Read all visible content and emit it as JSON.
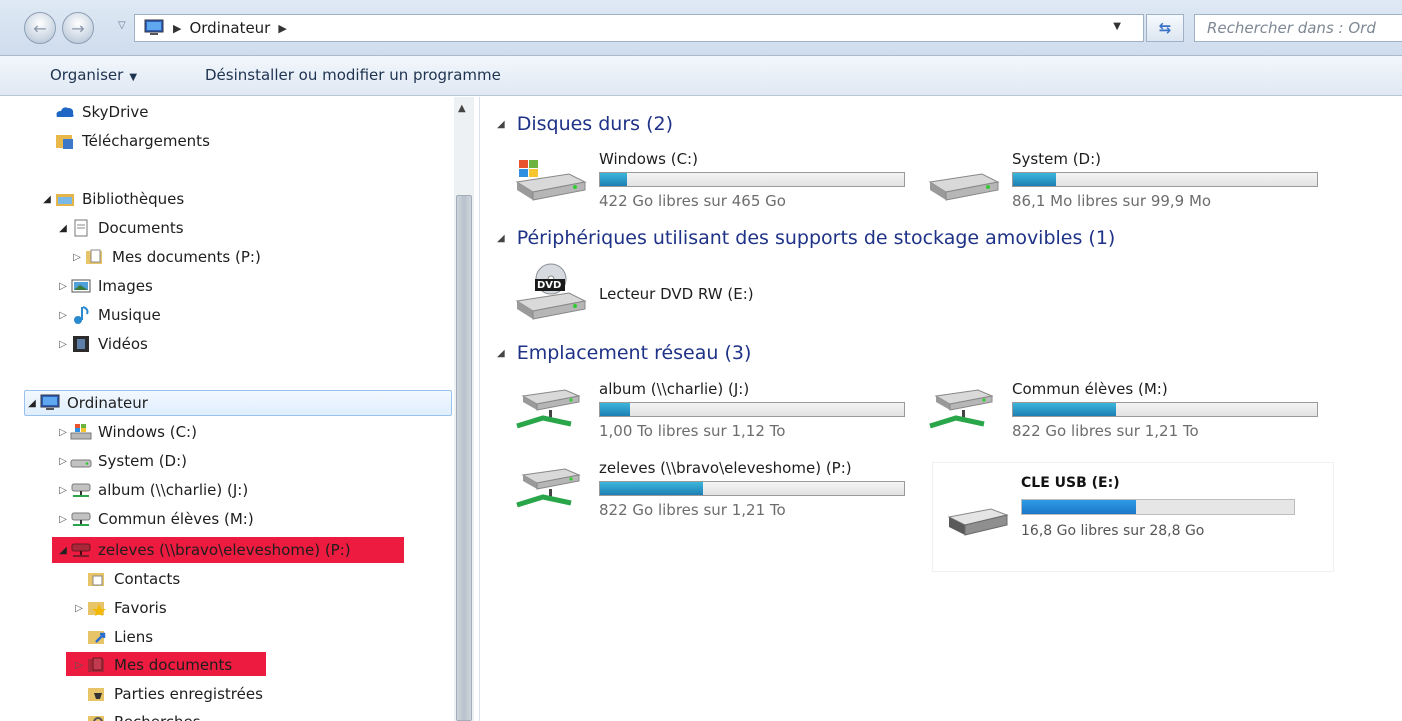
{
  "address_bar": {
    "breadcrumb": "Ordinateur",
    "search_placeholder": "Rechercher dans : Ord"
  },
  "command_bar": {
    "organize_label": "Organiser",
    "uninstall_label": "Désinstaller ou modifier un programme"
  },
  "nav": {
    "items": [
      {
        "label": "SkyDrive"
      },
      {
        "label": "Téléchargements"
      },
      {
        "label": "Bibliothèques"
      },
      {
        "label": "Documents"
      },
      {
        "label": "Mes documents (P:)"
      },
      {
        "label": "Images"
      },
      {
        "label": "Musique"
      },
      {
        "label": "Vidéos"
      },
      {
        "label": "Ordinateur"
      },
      {
        "label": "Windows (C:)"
      },
      {
        "label": "System (D:)"
      },
      {
        "label": "album (\\\\charlie) (J:)"
      },
      {
        "label": "Commun élèves (M:)"
      },
      {
        "label": "zeleves (\\\\bravo\\eleveshome) (P:)"
      },
      {
        "label": "Contacts"
      },
      {
        "label": "Favoris"
      },
      {
        "label": "Liens"
      },
      {
        "label": "Mes documents"
      },
      {
        "label": "Parties enregistrées"
      },
      {
        "label": "Recherches"
      }
    ]
  },
  "content": {
    "groups": [
      {
        "title": "Disques durs (2)"
      },
      {
        "title": "Périphériques utilisant des supports de stockage amovibles (1)"
      },
      {
        "title": "Emplacement réseau (3)"
      }
    ],
    "drives": [
      {
        "name": "Windows (C:)",
        "free": "422 Go libres sur 465 Go",
        "used_fraction": 0.09
      },
      {
        "name": "System (D:)",
        "free": "86,1 Mo libres sur 99,9 Mo",
        "used_fraction": 0.14
      },
      {
        "name": "Lecteur DVD RW (E:)",
        "badge": "DVD"
      },
      {
        "name": "album (\\\\charlie) (J:)",
        "free": "1,00 To libres sur 1,12 To",
        "used_fraction": 0.1
      },
      {
        "name": "Commun élèves (M:)",
        "free": "822 Go libres sur 1,21 To",
        "used_fraction": 0.34
      },
      {
        "name": "zeleves (\\\\bravo\\eleveshome) (P:)",
        "free": "822 Go libres sur 1,21 To",
        "used_fraction": 0.34
      },
      {
        "name": "CLE USB (E:)",
        "free": "16,8 Go libres sur 28,8 Go",
        "used_fraction": 0.42
      }
    ]
  },
  "colors": {
    "group_title": "#1e3287",
    "bar_fill": "#1d7fb3",
    "usb_fill": "#1b78c8",
    "highlight_red": "#ec1b3f",
    "selection": "#dfeefd"
  },
  "icons": [
    "back-icon",
    "forward-icon",
    "computer-icon",
    "refresh-icon",
    "cloud-icon",
    "folder-icon",
    "library-icon",
    "hard-drive-icon",
    "network-drive-icon",
    "dvd-drive-icon",
    "usb-drive-icon"
  ]
}
